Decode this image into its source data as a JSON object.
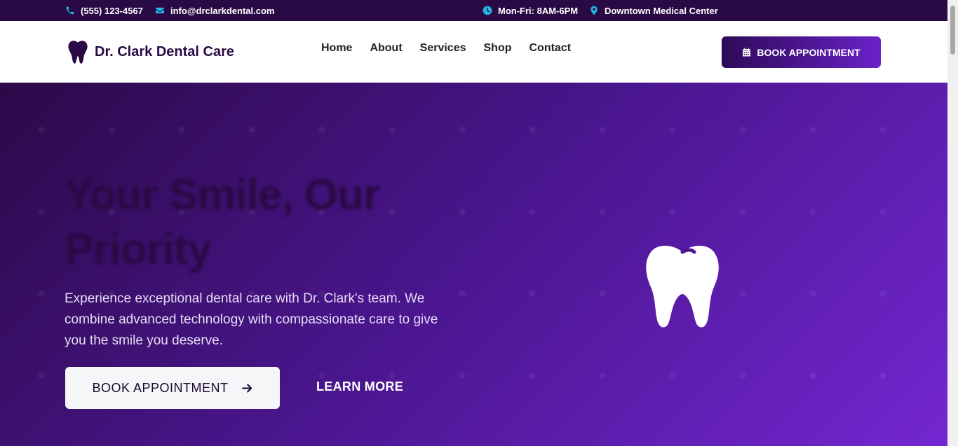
{
  "topbar": {
    "phone": "(555) 123-4567",
    "email": "info@drclarkdental.com",
    "hours": "Mon-Fri: 8AM-6PM",
    "location": "Downtown Medical Center",
    "icon_color": "#1fb6e0"
  },
  "header": {
    "brand": "Dr. Clark Dental Care",
    "nav": [
      {
        "label": "Home"
      },
      {
        "label": "About"
      },
      {
        "label": "Services"
      },
      {
        "label": "Shop"
      },
      {
        "label": "Contact"
      }
    ],
    "cta_label": "BOOK APPOINTMENT"
  },
  "hero": {
    "title": "Your Smile, Our Priority",
    "description": "Experience exceptional dental care with Dr. Clark's team. We combine advanced technology with compassionate care to give you the smile you deserve.",
    "primary_cta": "BOOK APPOINTMENT",
    "secondary_cta": "LEARN MORE"
  },
  "colors": {
    "brand_dark": "#2a0a45",
    "accent_purple": "#6a22c8"
  }
}
